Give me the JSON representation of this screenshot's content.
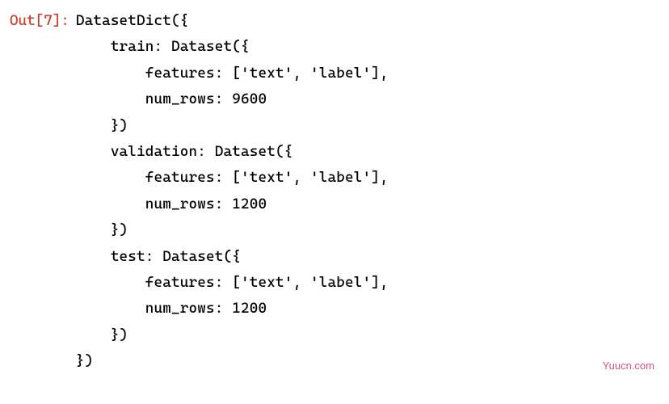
{
  "prompt": "Out[7]:",
  "code": {
    "l1": "DatasetDict({",
    "l2": "    train: Dataset({",
    "l3": "        features: ['text', 'label'],",
    "l4": "        num_rows: 9600",
    "l5": "    })",
    "l6": "    validation: Dataset({",
    "l7": "        features: ['text', 'label'],",
    "l8": "        num_rows: 1200",
    "l9": "    })",
    "l10": "    test: Dataset({",
    "l11": "        features: ['text', 'label'],",
    "l12": "        num_rows: 1200",
    "l13": "    })",
    "l14": "})"
  },
  "watermark": "Yuucn.com"
}
